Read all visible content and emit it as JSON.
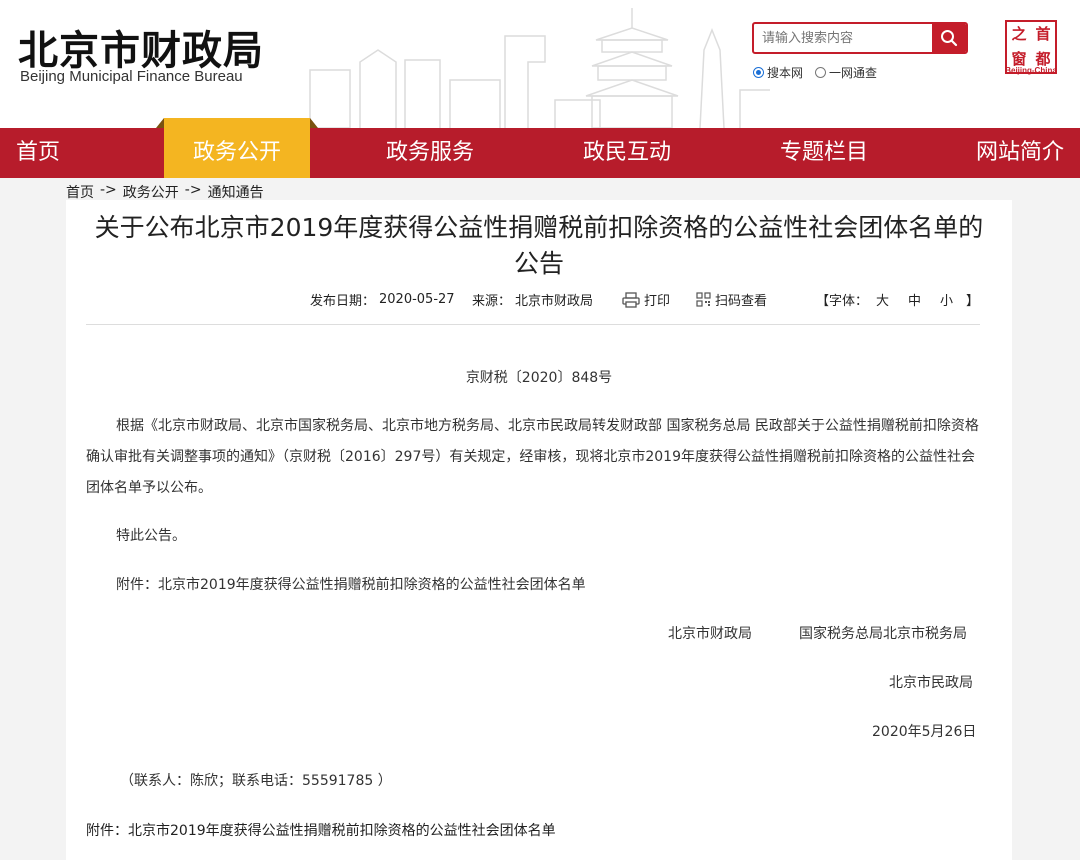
{
  "header": {
    "logo_cn": "北京市财政局",
    "logo_en": "Beijing Municipal Finance Bureau",
    "search_placeholder": "请输入搜索内容",
    "search_icon": "search-icon",
    "radio_options": [
      {
        "label": "搜本网",
        "checked": true
      },
      {
        "label": "一网通查",
        "checked": false
      }
    ],
    "seal_chars": [
      "首",
      "都",
      "之",
      "窗"
    ],
    "seal_caption": "Beijing-China"
  },
  "nav": {
    "items": [
      "首页",
      "政务公开",
      "政务服务",
      "政民互动",
      "专题栏目",
      "网站简介"
    ],
    "active_index": 1
  },
  "breadcrumb": {
    "items": [
      "首页",
      "政务公开",
      "通知通告"
    ],
    "separator": "->"
  },
  "article": {
    "title": "关于公布北京市2019年度获得公益性捐赠税前扣除资格的公益性社会团体名单的公告",
    "publish_label": "发布日期：",
    "publish_date": "2020-05-27",
    "source_label": "来源：",
    "source": "北京市财政局",
    "print_label": "打印",
    "qr_label": "扫码查看",
    "font_label": "【字体：",
    "font_sizes": [
      "大",
      "中",
      "小"
    ],
    "font_close": "】",
    "doc_number": "京财税〔2020〕848号",
    "body": "根据《北京市财政局、北京市国家税务局、北京市地方税务局、北京市民政局转发财政部 国家税务总局 民政部关于公益性捐赠税前扣除资格确认审批有关调整事项的通知》（京财税〔2016〕297号）有关规定，经审核，现将北京市2019年度获得公益性捐赠税前扣除资格的公益性社会团体名单予以公布。",
    "notice": "特此公告。",
    "attachment_line": "附件：北京市2019年度获得公益性捐赠税前扣除资格的公益性社会团体名单",
    "signatory_1": "北京市财政局",
    "signatory_2": "国家税务总局北京市税务局",
    "signatory_3": "北京市民政局",
    "sign_date": "2020年5月26日",
    "contact": "（联系人：陈欣；联系电话：55591785 ）",
    "attachment_link": "附件：北京市2019年度获得公益性捐赠税前扣除资格的公益性社会团体名单"
  },
  "colors": {
    "brand_red": "#b71c2b",
    "active_gold": "#f4b521"
  }
}
